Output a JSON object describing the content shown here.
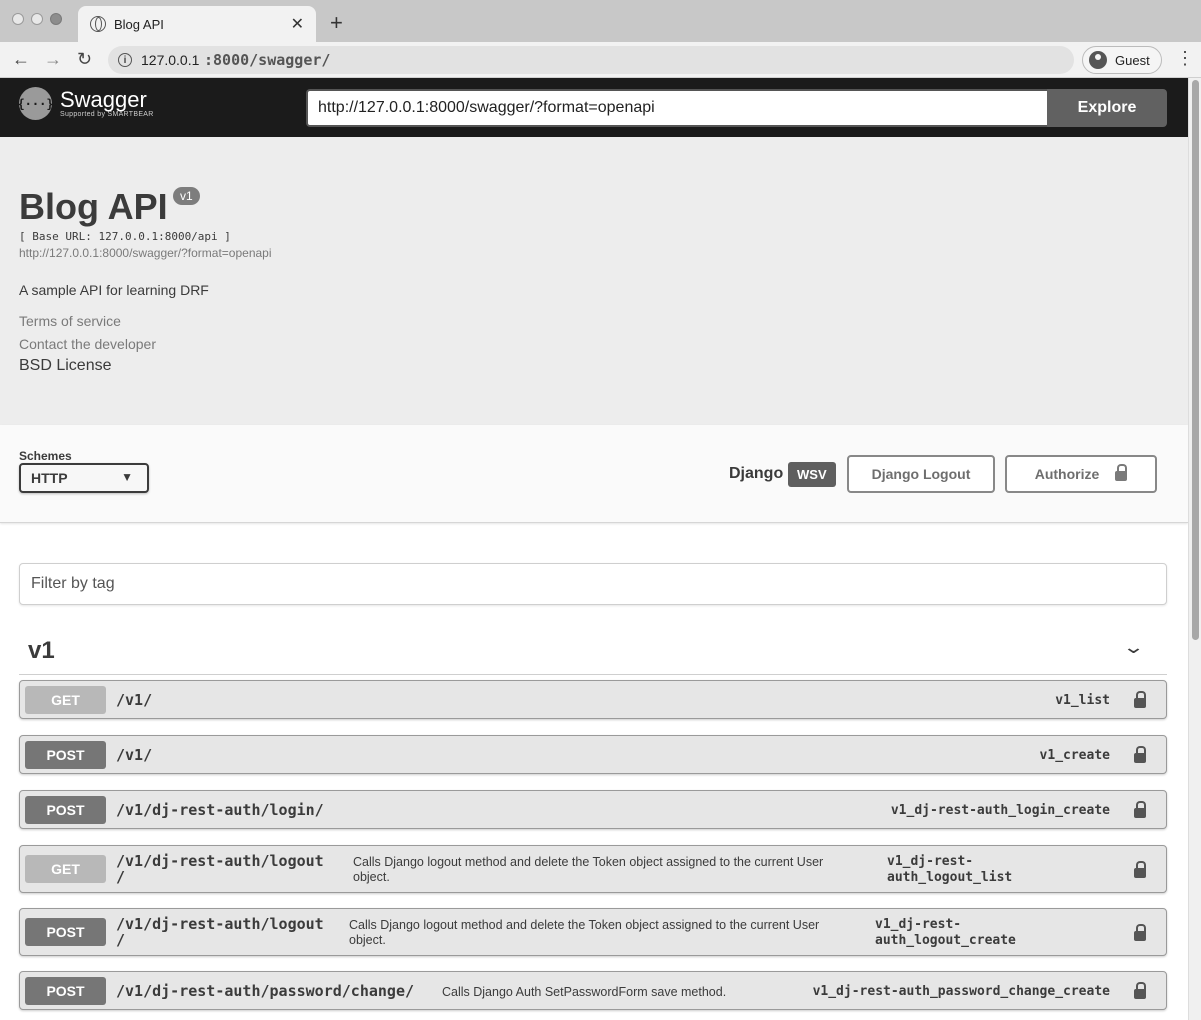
{
  "browser": {
    "tab_title": "Blog API",
    "tab_close": "✕",
    "new_tab": "+",
    "url_host": "127.0.0.1",
    "url_path": ":8000/swagger/",
    "profile": "Guest"
  },
  "topbar": {
    "logo_mark": "{···}",
    "logo_text": "Swagger",
    "logo_sub": "Supported by SMARTBEAR",
    "spec_url": "http://127.0.0.1:8000/swagger/?format=openapi",
    "explore_label": "Explore"
  },
  "info": {
    "title": "Blog API",
    "version": "v1",
    "base_url": "[ Base URL: 127.0.0.1:8000/api ]",
    "spec_link": "http://127.0.0.1:8000/swagger/?format=openapi",
    "description": "A sample API for learning DRF",
    "terms": "Terms of service",
    "contact": "Contact the developer",
    "license": "BSD License"
  },
  "schemes": {
    "label": "Schemes",
    "selected": "HTTP",
    "django_label": "Django",
    "wsv_badge": "WSV",
    "logout_label": "Django Logout",
    "authorize_label": "Authorize"
  },
  "filter": {
    "placeholder": "Filter by tag"
  },
  "tag": {
    "name": "v1"
  },
  "operations": [
    {
      "method": "GET",
      "path": "/v1/",
      "summary": "",
      "op_id": "v1_list"
    },
    {
      "method": "POST",
      "path": "/v1/",
      "summary": "",
      "op_id": "v1_create"
    },
    {
      "method": "POST",
      "path": "/v1/dj-rest-auth/login/",
      "summary": "",
      "op_id": "v1_dj-rest-auth_login_create"
    },
    {
      "method": "GET",
      "path_line1": "/v1/dj-rest-auth/logout",
      "path_line2": "/",
      "summary_line1": "Calls Django logout method and delete the Token object assigned to the current User",
      "summary_line2": "object.",
      "op_id_line1": "v1_dj-rest-",
      "op_id_line2": "auth_logout_list"
    },
    {
      "method": "POST",
      "path_line1": "/v1/dj-rest-auth/logout",
      "path_line2": "/",
      "summary_line1": "Calls Django logout method and delete the Token object assigned to the current User",
      "summary_line2": "object.",
      "op_id_line1": "v1_dj-rest-",
      "op_id_line2": "auth_logout_create"
    },
    {
      "method": "POST",
      "path": "/v1/dj-rest-auth/password/change/",
      "summary": "Calls Django Auth SetPasswordForm save method.",
      "op_id": "v1_dj-rest-auth_password_change_create"
    }
  ]
}
